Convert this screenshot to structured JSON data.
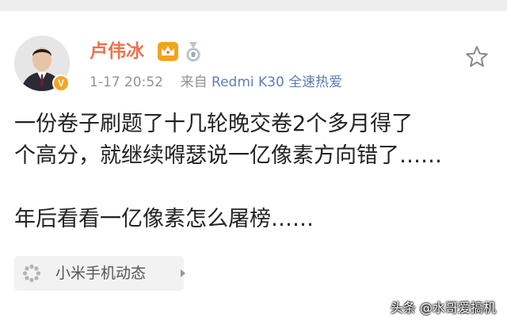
{
  "post": {
    "author": {
      "name": "卢伟冰",
      "verified_icon": "verified-v-icon",
      "badge_icons": [
        "crown-icon",
        "medal-icon"
      ]
    },
    "meta": {
      "timestamp": "1-17 20:52",
      "source_prefix": "来自",
      "source_device": "Redmi K30 全速热爱"
    },
    "text_lines": [
      "一份卷子刷题了十几轮晚交卷2个多月得了",
      "个高分，就继续嘚瑟说一亿像素方向错了……",
      "",
      "年后看看一亿像素怎么屠榜……"
    ],
    "tag": {
      "icon": "loading-dots-icon",
      "label": "小米手机动态"
    },
    "favorite_icon": "star-outline-icon"
  },
  "watermark": "头条 @水哥爱搞机",
  "colors": {
    "username": "#eb7350",
    "source_link": "#5d7eb4",
    "meta_gray": "#939393",
    "body_text": "#222222",
    "verified_badge": "#f5a623",
    "tag_background": "#f2f2f2"
  }
}
